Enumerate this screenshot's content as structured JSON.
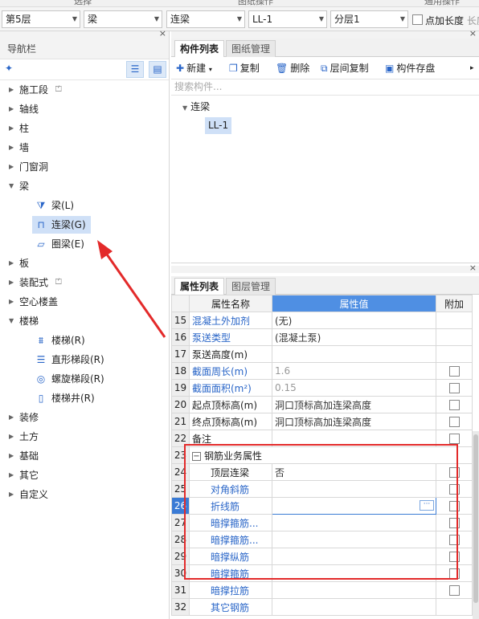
{
  "topstrip": {
    "left": "选择",
    "mid": "图纸操作",
    "right": "通用操作"
  },
  "toolbar": {
    "floor": "第5层",
    "type": "梁",
    "subtype": "连梁",
    "component": "LL-1",
    "layer": "分层1",
    "check_label": "点加长度",
    "check_tail": "长度"
  },
  "nav": {
    "title": "导航栏",
    "close": "×",
    "pin": "⁺",
    "items": [
      {
        "label": "施工段",
        "lock": true
      },
      {
        "label": "轴线"
      },
      {
        "label": "柱"
      },
      {
        "label": "墙"
      },
      {
        "label": "门窗洞"
      },
      {
        "label": "梁",
        "expanded": true
      },
      {
        "label": "板"
      },
      {
        "label": "装配式",
        "lock": true
      },
      {
        "label": "空心楼盖"
      },
      {
        "label": "楼梯",
        "expanded": true
      },
      {
        "label": "装修"
      },
      {
        "label": "土方"
      },
      {
        "label": "基础"
      },
      {
        "label": "其它"
      },
      {
        "label": "自定义"
      }
    ],
    "beam_children": [
      {
        "label": "梁(L)",
        "icon": "beam-icon"
      },
      {
        "label": "连梁(G)",
        "icon": "coupling-beam-icon",
        "selected": true
      },
      {
        "label": "圈梁(E)",
        "icon": "ring-beam-icon"
      }
    ],
    "stair_children": [
      {
        "label": "楼梯(R)",
        "icon": "stair-icon"
      },
      {
        "label": "直形梯段(R)",
        "icon": "straight-flight-icon"
      },
      {
        "label": "螺旋梯段(R)",
        "icon": "spiral-flight-icon"
      },
      {
        "label": "楼梯井(R)",
        "icon": "stairwell-icon"
      }
    ]
  },
  "components": {
    "tabs": [
      "构件列表",
      "图纸管理"
    ],
    "buttons": {
      "new": "新建",
      "copy": "复制",
      "delete": "删除",
      "floor_copy": "层间复制",
      "save": "构件存盘"
    },
    "search_placeholder": "搜索构件...",
    "tree_root": "连梁",
    "tree_item": "LL-1"
  },
  "properties": {
    "tabs": [
      "属性列表",
      "图层管理"
    ],
    "headers": {
      "name": "属性名称",
      "value": "属性值",
      "add": "附加"
    },
    "rows": [
      {
        "no": "15",
        "name": "混凝土外加剂",
        "value": "(无)",
        "blue": true
      },
      {
        "no": "16",
        "name": "泵送类型",
        "value": "(混凝土泵)",
        "blue": true
      },
      {
        "no": "17",
        "name": "泵送高度(m)",
        "value": "",
        "blue": false
      },
      {
        "no": "18",
        "name": "截面周长(m)",
        "value": "1.6",
        "blue": true,
        "gray": true,
        "check": true
      },
      {
        "no": "19",
        "name": "截面面积(m²)",
        "value": "0.15",
        "blue": true,
        "gray": true,
        "check": true
      },
      {
        "no": "20",
        "name": "起点顶标高(m)",
        "value": "洞口顶标高加连梁高度",
        "blue": false,
        "check": true
      },
      {
        "no": "21",
        "name": "终点顶标高(m)",
        "value": "洞口顶标高加连梁高度",
        "blue": false,
        "check": true
      },
      {
        "no": "22",
        "name": "备注",
        "value": "",
        "blue": false,
        "check": true
      },
      {
        "no": "23",
        "name": "钢筋业务属性",
        "value": "",
        "group": true
      },
      {
        "no": "24",
        "name": "顶层连梁",
        "value": "否",
        "blue": false,
        "indent": true,
        "check": true
      },
      {
        "no": "25",
        "name": "对角斜筋",
        "value": "",
        "blue": true,
        "indent": true,
        "check": true
      },
      {
        "no": "26",
        "name": "折线筋",
        "value": "",
        "blue": true,
        "indent": true,
        "check": true,
        "editing": true
      },
      {
        "no": "27",
        "name": "暗撑箍筋...",
        "value": "",
        "blue": true,
        "indent": true,
        "check": true
      },
      {
        "no": "28",
        "name": "暗撑箍筋...",
        "value": "",
        "blue": true,
        "indent": true,
        "check": true
      },
      {
        "no": "29",
        "name": "暗撑纵筋",
        "value": "",
        "blue": true,
        "indent": true,
        "check": true
      },
      {
        "no": "30",
        "name": "暗撑箍筋",
        "value": "",
        "blue": true,
        "indent": true,
        "check": true
      },
      {
        "no": "31",
        "name": "暗撑拉筋",
        "value": "",
        "blue": true,
        "indent": true,
        "check": true
      },
      {
        "no": "32",
        "name": "其它钢筋",
        "value": "",
        "blue": true,
        "indent": true,
        "check": false
      }
    ]
  },
  "colors": {
    "accent": "#3a7bd5",
    "annotation": "#e32a2a",
    "selection": "#cfe0f7"
  }
}
